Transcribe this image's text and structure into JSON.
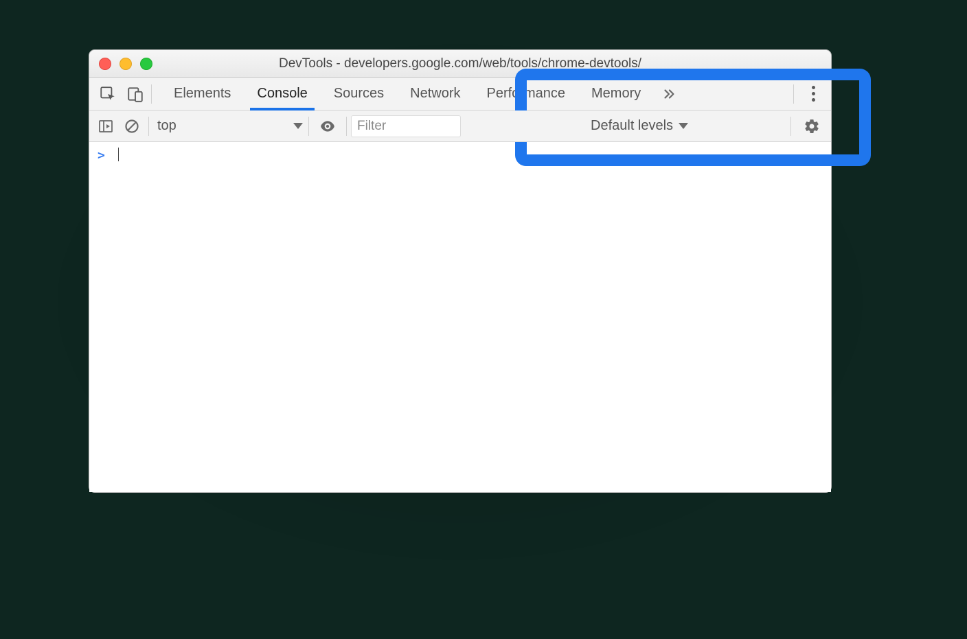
{
  "window": {
    "title": "DevTools - developers.google.com/web/tools/chrome-devtools/"
  },
  "tabstrip": {
    "tabs": [
      {
        "label": "Elements"
      },
      {
        "label": "Console"
      },
      {
        "label": "Sources"
      },
      {
        "label": "Network"
      },
      {
        "label": "Performance"
      },
      {
        "label": "Memory"
      }
    ],
    "active_index": 1
  },
  "console_toolbar": {
    "context": "top",
    "filter_placeholder": "Filter",
    "levels_label": "Default levels"
  },
  "console": {
    "prompt": ">"
  }
}
